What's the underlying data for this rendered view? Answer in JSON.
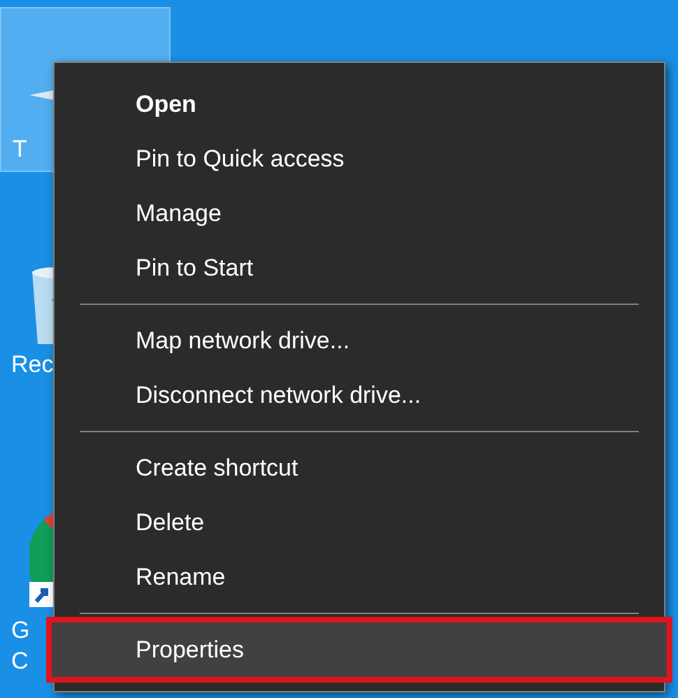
{
  "desktop_icons": [
    {
      "kind": "monitor",
      "label": [
        "T"
      ],
      "selected": true
    },
    {
      "kind": "bin",
      "label": [
        "Rec"
      ],
      "selected": false
    },
    {
      "kind": "chrome",
      "label": [
        "G",
        "C"
      ],
      "selected": false
    }
  ],
  "context_menu": {
    "sections": [
      [
        {
          "label": "Open",
          "default": true,
          "selected": false,
          "outlined": false
        },
        {
          "label": "Pin to Quick access",
          "default": false,
          "selected": false,
          "outlined": false
        },
        {
          "label": "Manage",
          "default": false,
          "selected": false,
          "outlined": false
        },
        {
          "label": "Pin to Start",
          "default": false,
          "selected": false,
          "outlined": false
        }
      ],
      [
        {
          "label": "Map network drive...",
          "default": false,
          "selected": false,
          "outlined": false
        },
        {
          "label": "Disconnect network drive...",
          "default": false,
          "selected": false,
          "outlined": false
        }
      ],
      [
        {
          "label": "Create shortcut",
          "default": false,
          "selected": false,
          "outlined": false
        },
        {
          "label": "Delete",
          "default": false,
          "selected": false,
          "outlined": false
        },
        {
          "label": "Rename",
          "default": false,
          "selected": false,
          "outlined": false
        }
      ],
      [
        {
          "label": "Properties",
          "default": false,
          "selected": true,
          "outlined": true
        }
      ]
    ]
  }
}
